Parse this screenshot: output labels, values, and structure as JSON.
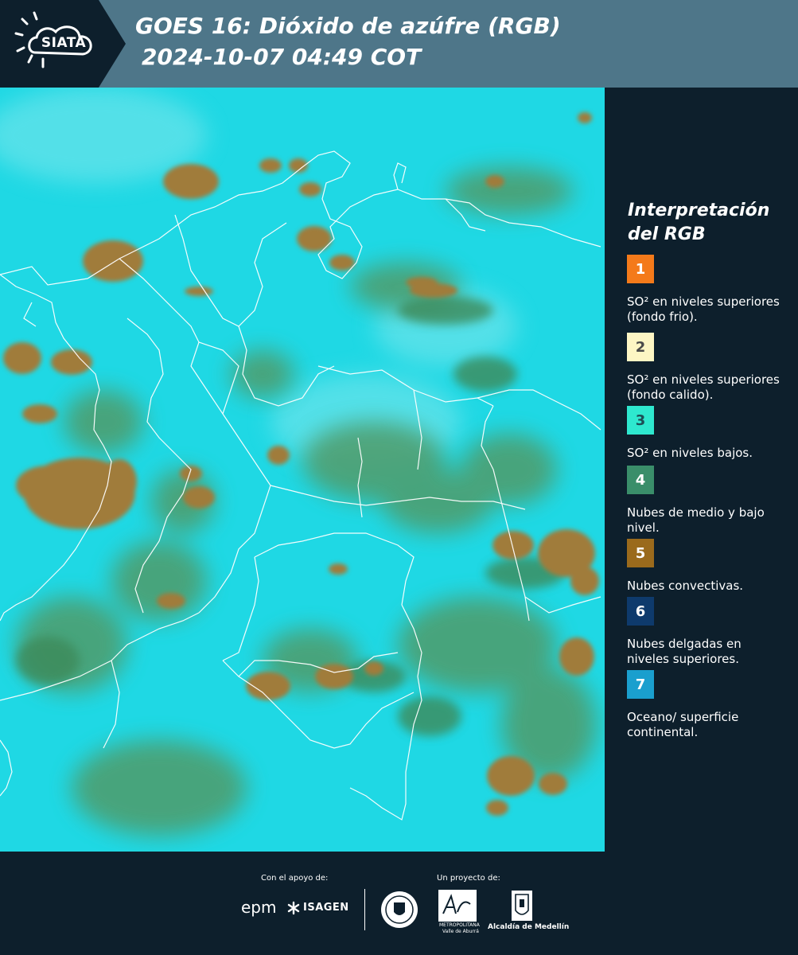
{
  "header": {
    "logo_text": "SIATA",
    "title_line1": "GOES 16: Dióxido de azúfre (RGB)",
    "title_line2": "2024-10-07 04:49 COT"
  },
  "legend": {
    "title_line1": "Interpretación",
    "title_line2": "del RGB",
    "items": [
      {
        "number": "1",
        "label": "SO² en niveles superiores (fondo frio).",
        "color": "#f47a1a",
        "text_color": "#ffffff"
      },
      {
        "number": "2",
        "label": "SO² en niveles superiores (fondo calido).",
        "color": "#fdf6c4",
        "text_color": "#4a4a4a"
      },
      {
        "number": "3",
        "label": "SO² en niveles bajos.",
        "color": "#2ee8cf",
        "text_color": "#1d4e56"
      },
      {
        "number": "4",
        "label": "Nubes de medio y bajo nivel.",
        "color": "#3a8e6a",
        "text_color": "#ffffff"
      },
      {
        "number": "5",
        "label": "Nubes convectivas.",
        "color": "#9a6a1c",
        "text_color": "#ffffff"
      },
      {
        "number": "6",
        "label": "Nubes delgadas en niveles superiores.",
        "color": "#0e3a6c",
        "text_color": "#ffffff"
      },
      {
        "number": "7",
        "label": "Oceano/ superficie continental.",
        "color": "#1a9fce",
        "text_color": "#ffffff"
      }
    ]
  },
  "footer": {
    "support_label": "Con el apoyo de:",
    "project_label": "Un proyecto de:",
    "sponsor1": "epm",
    "sponsor2": "ISAGEN",
    "partner1": "METROPOLITANA",
    "partner1_sub": "Valle de Aburrá",
    "partner2": "Alcaldía de Medellín"
  },
  "colors": {
    "header_bg": "#4e7689",
    "panel_bg": "#0d1f2c",
    "ocean": "#17d9e2",
    "convective": "#9a7a3c",
    "low_clouds": "#4f9f6a"
  }
}
